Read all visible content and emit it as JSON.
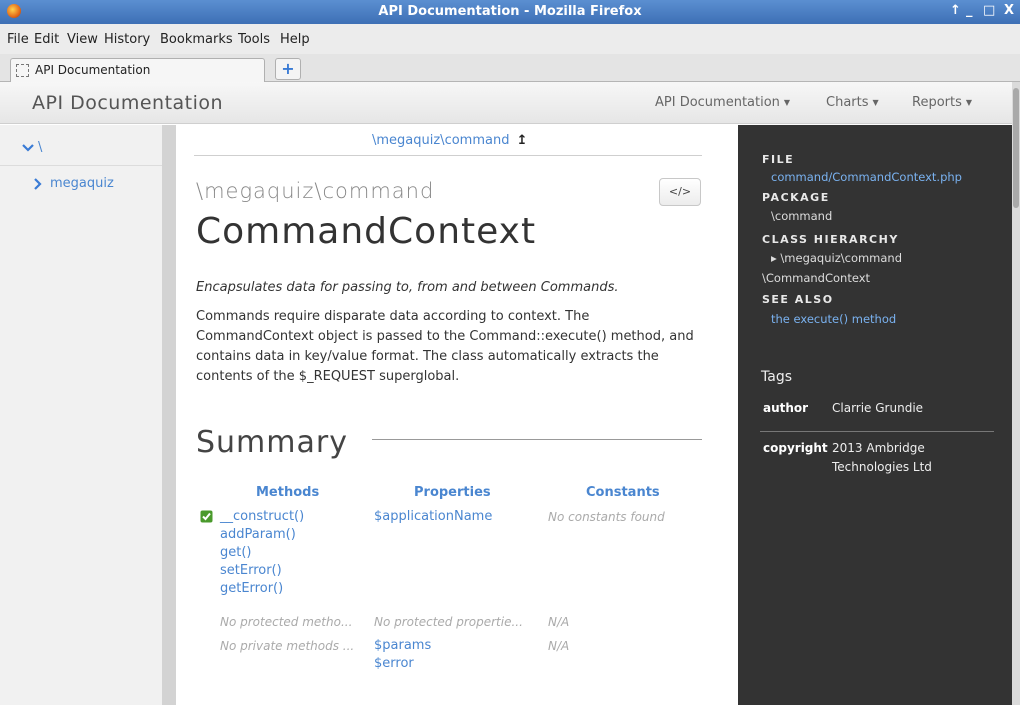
{
  "window": {
    "title": "API Documentation - Mozilla Firefox",
    "controls": [
      "↑",
      "_",
      "□",
      "X"
    ]
  },
  "menu": [
    "File",
    "Edit",
    "View",
    "History",
    "Bookmarks",
    "Tools",
    "Help"
  ],
  "tabs": {
    "active_label": "API Documentation",
    "new_tab_label": "+"
  },
  "navbar": {
    "brand": "API Documentation",
    "items": [
      "API Documentation",
      "Charts",
      "Reports"
    ],
    "caret": "▼"
  },
  "sidebar": {
    "root_label": "\\",
    "root_chevron": "⌄",
    "item_label": "megaquiz",
    "item_chevron": "›"
  },
  "content": {
    "breadcrumb": "\\megaquiz\\command",
    "breadcrumb_arrow": "↥",
    "namespace": "\\megaquiz\\command",
    "source_button": "</>",
    "class_name": "CommandContext",
    "short_description": "Encapsulates data for passing to, from and between Commands.",
    "long_description": "Commands require disparate data according to context. The CommandContext object is passed to the Command::execute() method, and contains data in key/value format. The class automatically extracts the contents of the $_REQUEST superglobal.",
    "summary_heading": "Summary",
    "summary": {
      "headers": [
        "Methods",
        "Properties",
        "Constants"
      ],
      "methods": [
        "__construct()",
        "addParam()",
        "get()",
        "setError()",
        "getError()"
      ],
      "properties": [
        "$applicationName"
      ],
      "constants_empty": "No constants found",
      "protected_row": [
        "No protected metho...",
        "No protected propertie...",
        "N/A"
      ],
      "private_row_methods": "No private methods ...",
      "private_properties": [
        "$params",
        "$error"
      ],
      "private_constants": "N/A"
    }
  },
  "details": {
    "file_label": "FILE",
    "file_value": "command/CommandContext.php",
    "package_label": "PACKAGE",
    "package_value": "\\command",
    "hierarchy_label": "CLASS HIERARCHY",
    "hierarchy_line1": "▸ \\megaquiz\\command",
    "hierarchy_line2": "\\CommandContext",
    "see_also_label": "SEE ALSO",
    "see_also_value": "the execute() method",
    "tags_heading": "Tags",
    "tags": [
      {
        "key": "author",
        "value": "Clarrie Grundie"
      },
      {
        "key": "copyright",
        "value": "2013 Ambridge Technologies Ltd"
      }
    ]
  },
  "colors": {
    "link": "#4a86d0",
    "panel_bg": "#333333",
    "titlebar": "#3d6fb5"
  }
}
